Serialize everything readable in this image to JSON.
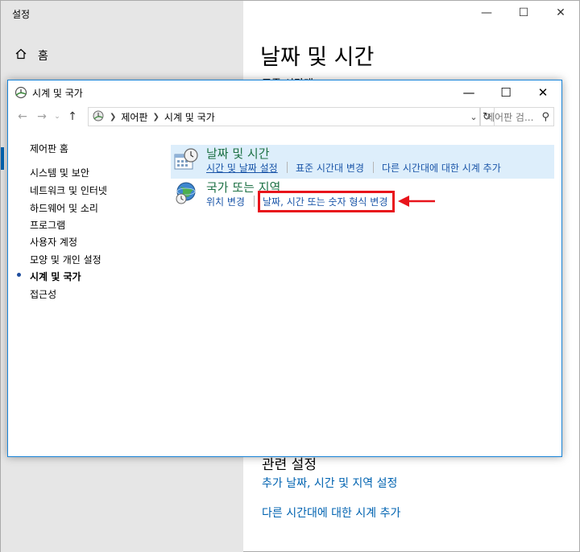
{
  "settings": {
    "title": "설정",
    "home_label": "홈",
    "heading": "날짜 및 시간",
    "sub_heading": "표준 시간대",
    "related_heading": "관련 설정",
    "links": [
      "추가 날짜, 시간 및 지역 설정",
      "다른 시간대에 대한 시계 추가"
    ]
  },
  "control_panel": {
    "title": "시계 및 국가",
    "breadcrumb": [
      "제어판",
      "시계 및 국가"
    ],
    "search_placeholder": "제어판 검...",
    "sidebar": {
      "home": "제어판 홈",
      "items": [
        "시스템 및 보안",
        "네트워크 및 인터넷",
        "하드웨어 및 소리",
        "프로그램",
        "사용자 계정",
        "모양 및 개인 설정",
        "시계 및 국가",
        "접근성"
      ],
      "active": "시계 및 국가"
    },
    "categories": [
      {
        "title": "날짜 및 시간",
        "links": [
          "시간 및 날짜 설정",
          "표준 시간대 변경",
          "다른 시간대에 대한 시계 추가"
        ]
      },
      {
        "title": "국가 또는 지역",
        "links": [
          "위치 변경",
          "날짜, 시간 또는 숫자 형식 변경"
        ]
      }
    ]
  },
  "colors": {
    "accent": "#0063b1",
    "link": "#1a55a8",
    "category_title": "#1e7145",
    "highlight": "#e8141b",
    "selected_category_bg": "#ddeefb"
  }
}
